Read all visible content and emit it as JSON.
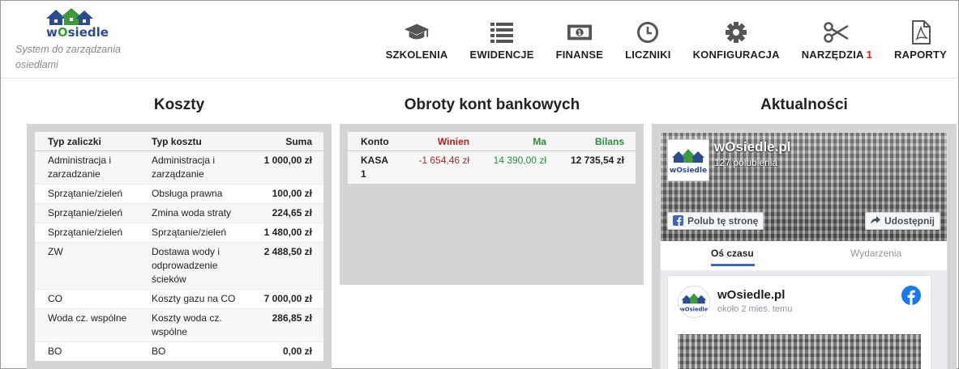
{
  "app": {
    "logo_text_w": "w",
    "logo_text_o": "O",
    "logo_text_rest": "siedle",
    "tagline": "System do zarządzania osiedlami"
  },
  "nav": [
    {
      "label": "SZKOLENIA",
      "icon": "graduation-cap-icon"
    },
    {
      "label": "EWIDENCJE",
      "icon": "list-icon"
    },
    {
      "label": "FINANSE",
      "icon": "banknote-icon"
    },
    {
      "label": "LICZNIKI",
      "icon": "clock-icon"
    },
    {
      "label": "KONFIGURACJA",
      "icon": "gear-icon"
    },
    {
      "label": "NARZĘDZIA",
      "badge": "1",
      "icon": "scissors-icon"
    },
    {
      "label": "RAPORTY",
      "icon": "pdf-file-icon"
    }
  ],
  "costs": {
    "title": "Koszty",
    "headers": [
      "Typ zaliczki",
      "Typ kosztu",
      "Suma"
    ],
    "rows": [
      [
        "Administracja i zarzadzanie",
        "Administracja i zarządzanie",
        "1 000,00 zł"
      ],
      [
        "Sprzątanie/zieleń",
        "Obsługa prawna",
        "100,00 zł"
      ],
      [
        "Sprzątanie/zieleń",
        "Zmina woda straty",
        "224,65 zł"
      ],
      [
        "Sprzątanie/zieleń",
        "Sprzątanie/zieleń",
        "1 480,00 zł"
      ],
      [
        "ZW",
        "Dostawa wody i odprowadzenie ścieków",
        "2 488,50 zł"
      ],
      [
        "CO",
        "Koszty gazu na CO",
        "7 000,00 zł"
      ],
      [
        "Woda cz. wspólne",
        "Koszty woda cz. wspólne",
        "286,85 zł"
      ],
      [
        "BO",
        "BO",
        "0,00 zł"
      ]
    ]
  },
  "bank": {
    "title": "Obroty kont bankowych",
    "headers": [
      "Konto",
      "Winien",
      "Ma",
      "Bilans"
    ],
    "rows": [
      [
        "KASA 1",
        "-1 654,46 zł",
        "14 390,00 zł",
        "12 735,54 zł"
      ]
    ]
  },
  "news": {
    "title": "Aktualności",
    "page_name": "wOsiedle.pl",
    "likes": "127 polubienia",
    "like_button": "Polub tę stronę",
    "share_button": "Udostępnij",
    "tab_active": "Oś czasu",
    "tab_inactive": "Wydarzenia",
    "post_name": "wOsiedle.pl",
    "post_time": "około 2 mies. temu"
  },
  "colors": {
    "accent_red": "#e0161c",
    "debit": "#a52a2a",
    "credit": "#2e8b3c",
    "facebook_blue": "#4267b2"
  }
}
